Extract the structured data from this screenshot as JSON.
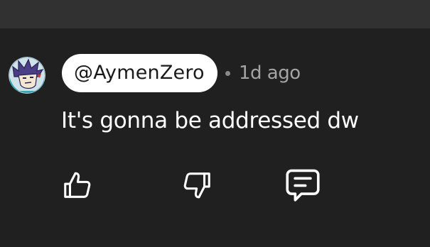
{
  "comment": {
    "author": "@AymenZero",
    "separator": "•",
    "timestamp": "1d ago",
    "text": "It's gonna be addressed dw"
  },
  "icons": {
    "avatar": "avatar-cartoon",
    "like": "thumbs-up-icon",
    "dislike": "thumbs-down-icon",
    "reply": "comment-icon"
  },
  "colors": {
    "background": "#202020",
    "top_bar": "#313131",
    "pill_background": "#ffffff",
    "text_primary": "#ffffff",
    "text_secondary": "#a4a4a4"
  }
}
